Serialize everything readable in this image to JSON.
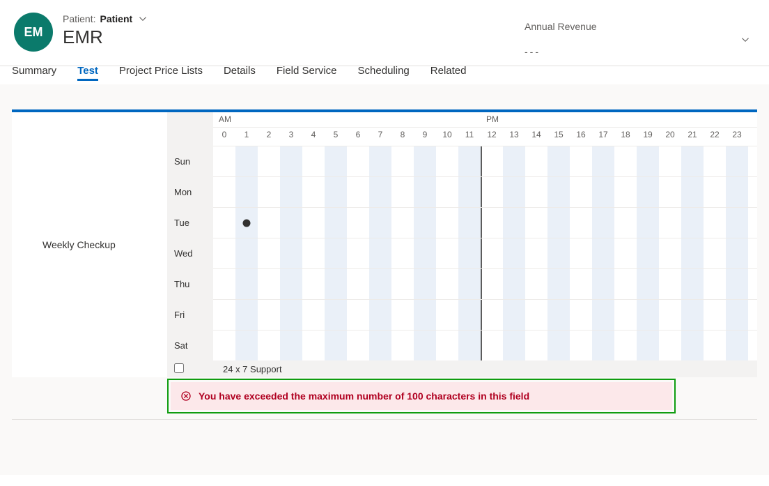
{
  "header": {
    "avatar_initials": "EM",
    "patient_label": "Patient:",
    "patient_name": "Patient",
    "app_title": "EMR",
    "revenue_label": "Annual Revenue",
    "revenue_value": "---"
  },
  "tabs": [
    {
      "label": "Summary",
      "active": false
    },
    {
      "label": "Test",
      "active": true
    },
    {
      "label": "Project Price Lists",
      "active": false
    },
    {
      "label": "Details",
      "active": false
    },
    {
      "label": "Field Service",
      "active": false
    },
    {
      "label": "Scheduling",
      "active": false
    },
    {
      "label": "Related",
      "active": false
    }
  ],
  "schedule": {
    "field_label": "Weekly Checkup",
    "am_label": "AM",
    "pm_label": "PM",
    "hours": [
      "0",
      "1",
      "2",
      "3",
      "4",
      "5",
      "6",
      "7",
      "8",
      "9",
      "10",
      "11",
      "12",
      "13",
      "14",
      "15",
      "16",
      "17",
      "18",
      "19",
      "20",
      "21",
      "22",
      "23"
    ],
    "days": [
      "Sun",
      "Mon",
      "Tue",
      "Wed",
      "Thu",
      "Fri",
      "Sat"
    ],
    "dot": {
      "day": "Tue",
      "hour": "1"
    },
    "support_label": "24 x 7 Support",
    "support_checked": false
  },
  "error": {
    "message": "You have exceeded the maximum number of 100 characters in this field"
  }
}
